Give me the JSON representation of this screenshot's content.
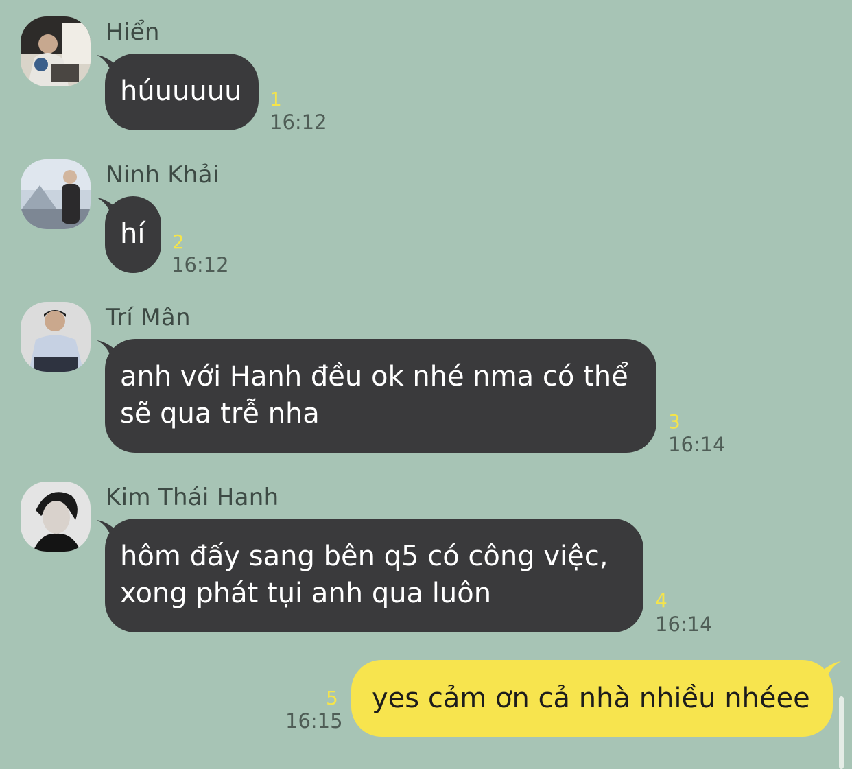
{
  "messages": [
    {
      "sender": "Hiển",
      "lines": [
        "húuuuuu"
      ],
      "read": "1",
      "time": "16:12"
    },
    {
      "sender": "Ninh Khải",
      "lines": [
        "hí"
      ],
      "read": "2",
      "time": "16:12"
    },
    {
      "sender": "Trí Mân",
      "lines": [
        "anh với Hanh đều ok nhé nma có thể",
        "sẽ qua trễ nha"
      ],
      "read": "3",
      "time": "16:14"
    },
    {
      "sender": "Kim Thái Hanh",
      "lines": [
        "hôm đấy sang bên q5 có công việc,",
        "xong phát tụi anh qua luôn"
      ],
      "read": "4",
      "time": "16:14"
    }
  ],
  "my_message": {
    "lines": [
      "yes cảm ơn cả nhà nhiều nhéee"
    ],
    "read": "5",
    "time": "16:15"
  },
  "colors": {
    "background": "#a7c4b5",
    "incoming_bubble": "#3a3a3c",
    "outgoing_bubble": "#f7e44e",
    "read_count": "#f5e44a"
  }
}
